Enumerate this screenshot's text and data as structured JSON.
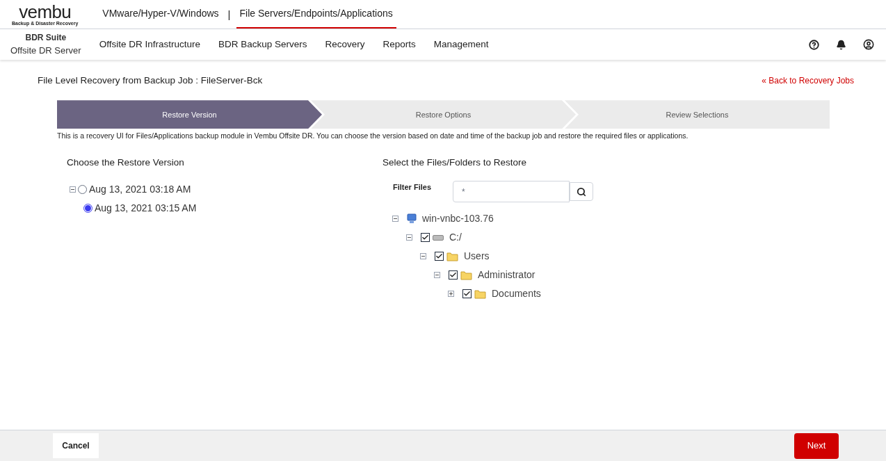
{
  "logo": {
    "name": "vembu",
    "tagline": "Backup & Disaster Recovery"
  },
  "top_tabs": [
    {
      "label": "VMware/Hyper-V/Windows",
      "selected": false
    },
    {
      "label": "File Servers/Endpoints/Applications",
      "selected": true
    }
  ],
  "top_separator": "|",
  "product": {
    "title": "BDR Suite",
    "subtitle": "Offsite DR Server"
  },
  "nav": [
    "Offsite DR Infrastructure",
    "BDR Backup Servers",
    "Recovery",
    "Reports",
    "Management"
  ],
  "page_title": "File Level Recovery from Backup Job : FileServer-Bck",
  "back_link": "« Back to Recovery Jobs",
  "steps": [
    {
      "label": "Restore Version",
      "selected": true
    },
    {
      "label": "Restore Options",
      "selected": false
    },
    {
      "label": "Review Selections",
      "selected": false
    }
  ],
  "description": "This is a recovery UI for Files/Applications backup module in Vembu Offsite DR. You can choose the version based on date and time of the backup job and restore the required files or applications.",
  "versions": {
    "title": "Choose the Restore Version",
    "items": [
      {
        "label": "Aug 13, 2021 03:18 AM",
        "selected": false,
        "expanded": true,
        "children": [
          {
            "label": "Aug 13, 2021 03:15 AM",
            "selected": true
          }
        ]
      }
    ]
  },
  "files": {
    "title": "Select the Files/Folders to Restore",
    "filter_label": "Filter Files",
    "filter_value": "*",
    "tree": [
      {
        "label": "win-vnbc-103.76",
        "kind": "computer",
        "expanded": true,
        "children": [
          {
            "label": "C:/",
            "kind": "drive",
            "checked": true,
            "expanded": true,
            "children": [
              {
                "label": "Users",
                "kind": "folder",
                "checked": true,
                "expanded": true,
                "children": [
                  {
                    "label": "Administrator",
                    "kind": "folder",
                    "checked": true,
                    "expanded": true,
                    "children": [
                      {
                        "label": "Documents",
                        "kind": "folder",
                        "checked": true,
                        "expanded": false
                      }
                    ]
                  }
                ]
              }
            ]
          }
        ]
      }
    ]
  },
  "buttons": {
    "cancel": "Cancel",
    "next": "Next"
  }
}
